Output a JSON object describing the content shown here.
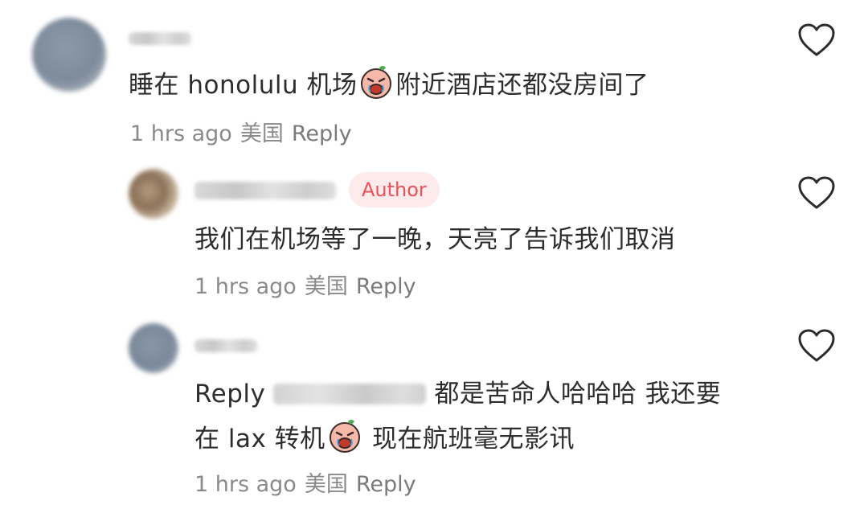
{
  "comments": [
    {
      "text_before": "睡在 honolulu 机场",
      "text_after": "附近酒店还都没房间了",
      "emoji": "crying-face-emoji",
      "time": "1 hrs ago",
      "location": "美国",
      "reply_label": "Reply"
    },
    {
      "badge": "Author",
      "text": "我们在机场等了一晚，天亮了告诉我们取消",
      "time": "1 hrs ago",
      "location": "美国",
      "reply_label": "Reply"
    },
    {
      "reply_prefix": "Reply",
      "text_line1_after": "都是苦命人哈哈哈 我还要",
      "text_line2_before": "在 lax 转机",
      "text_line2_after": " 现在航班毫无影讯",
      "emoji": "crying-face-emoji",
      "time": "1 hrs ago",
      "location": "美国",
      "reply_label": "Reply"
    }
  ],
  "icons": {
    "like": "heart-outline-icon"
  },
  "colors": {
    "author_badge_bg": "#fdeaea",
    "author_badge_text": "#e8525a",
    "meta": "#8a8a8a"
  }
}
